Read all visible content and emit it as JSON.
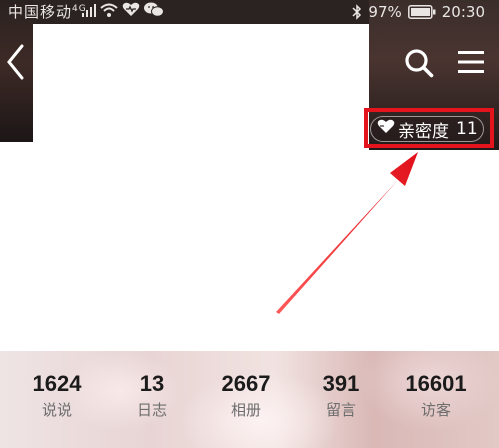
{
  "status_bar": {
    "carrier": "中国移动",
    "network_type": "4G",
    "battery": "97%",
    "time": "20:30",
    "icons": [
      "signal-icon",
      "wifi-icon",
      "heart-icon",
      "wechat-icon",
      "bluetooth-icon",
      "battery-icon"
    ]
  },
  "header": {
    "back_icon": "chevron-left-icon",
    "search_icon": "search-icon",
    "menu_icon": "menu-icon"
  },
  "intimacy": {
    "label": "亲密度",
    "value": "11",
    "icon": "heart-icon"
  },
  "stats": [
    {
      "value": "1624",
      "label": "说说"
    },
    {
      "value": "13",
      "label": "日志"
    },
    {
      "value": "2667",
      "label": "相册"
    },
    {
      "value": "391",
      "label": "留言"
    },
    {
      "value": "16601",
      "label": "访客"
    }
  ],
  "colors": {
    "highlight": "#e3141c",
    "status_text": "#e9e6e4"
  }
}
